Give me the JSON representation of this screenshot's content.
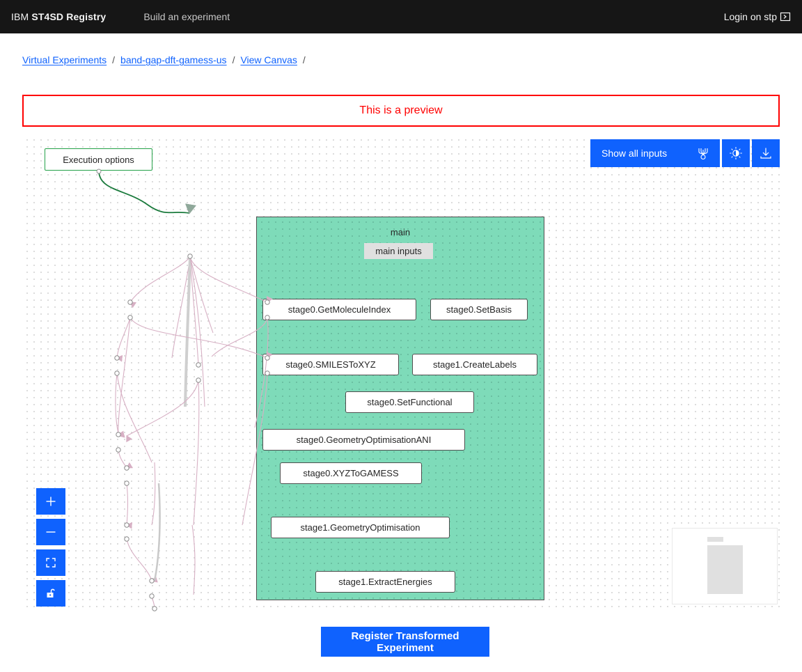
{
  "header": {
    "brand_light": "IBM",
    "brand_bold": "ST4SD Registry",
    "nav_item": "Build an experiment",
    "login_label": "Login on stp",
    "login_icon": "launch-icon"
  },
  "breadcrumb": {
    "items": [
      {
        "label": "Virtual Experiments"
      },
      {
        "label": "band-gap-dft-gamess-us"
      },
      {
        "label": "View Canvas"
      }
    ],
    "separator": "/"
  },
  "preview_banner": {
    "text": "This is a preview",
    "border_color": "#ff0000",
    "text_color": "#ff0000"
  },
  "canvas": {
    "toolbar": {
      "show_all_inputs_label": "Show all inputs",
      "show_all_inputs_icon": "flow-connection-icon",
      "brightness_icon": "brightness-contrast-icon",
      "download_icon": "download-icon"
    },
    "zoom_controls": [
      {
        "name": "zoom-in",
        "icon": "plus-icon"
      },
      {
        "name": "zoom-out",
        "icon": "minus-icon"
      },
      {
        "name": "fit-to-screen",
        "icon": "center-to-fit-icon"
      },
      {
        "name": "lock-canvas",
        "icon": "unlocked-padlock-icon"
      }
    ],
    "minimap": {
      "name": "minimap"
    }
  },
  "graph": {
    "group_label": "main",
    "external_node": {
      "label": "Execution options"
    },
    "inputs_node": {
      "label": "main inputs"
    },
    "nodes": [
      {
        "id": "n0",
        "label": "stage0.GetMoleculeIndex"
      },
      {
        "id": "n1",
        "label": "stage0.SetBasis"
      },
      {
        "id": "n2",
        "label": "stage0.SMILESToXYZ"
      },
      {
        "id": "n3",
        "label": "stage1.CreateLabels"
      },
      {
        "id": "n4",
        "label": "stage0.SetFunctional"
      },
      {
        "id": "n5",
        "label": "stage0.GeometryOptimisationANI"
      },
      {
        "id": "n6",
        "label": "stage0.XYZToGAMESS"
      },
      {
        "id": "n7",
        "label": "stage1.GeometryOptimisation"
      },
      {
        "id": "n8",
        "label": "stage1.ExtractEnergies"
      }
    ],
    "colors": {
      "group_fill": "#7edbb9",
      "node_border": "#4f4f4f",
      "external_node_border": "#24a148",
      "edge_color": "#d7b0c4",
      "external_edge_color": "#1a7a3c",
      "accent": "#0f62fe"
    }
  },
  "footer": {
    "register_label": "Register Transformed Experiment"
  }
}
